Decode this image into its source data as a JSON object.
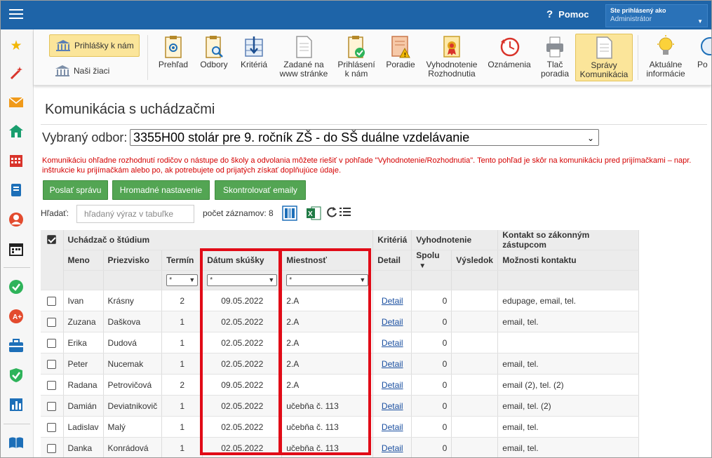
{
  "header": {
    "help_label": "Pomoc",
    "user_title": "Ste prihlásený ako",
    "user_name": "Administrátor"
  },
  "ribbon": {
    "left_buttons": [
      {
        "label": "Prihlášky k nám"
      },
      {
        "label": "Naši žiaci"
      }
    ],
    "items": [
      {
        "l1": "Prehľad",
        "l2": ""
      },
      {
        "l1": "Odbory",
        "l2": ""
      },
      {
        "l1": "Kritériá",
        "l2": ""
      },
      {
        "l1": "Zadané na",
        "l2": "www stránke"
      },
      {
        "l1": "Prihlásení",
        "l2": "k nám"
      },
      {
        "l1": "Poradie",
        "l2": ""
      },
      {
        "l1": "Vyhodnotenie",
        "l2": "Rozhodnutia"
      },
      {
        "l1": "Oznámenia",
        "l2": ""
      },
      {
        "l1": "Tlač",
        "l2": "poradia"
      },
      {
        "l1": "Správy",
        "l2": "Komunikácia"
      },
      {
        "l1": "Aktuálne",
        "l2": "informácie"
      },
      {
        "l1": "Po",
        "l2": ""
      }
    ]
  },
  "page": {
    "title": "Komunikácia s uchádzačmi",
    "odbor_label": "Vybraný odbor:",
    "odbor_value": "3355H00 stolár pre 9. ročník ZŠ - do SŠ duálne vzdelávanie",
    "warning": "Komunikáciu ohľadne rozhodnutí rodičov o nástupe do školy a odvolania môžete riešiť v pohľade \"Vyhodnotenie/Rozhodnutia\". Tento pohľad je skôr na komunikáciu pred prijímačkami – napr. inštrukcie ku prijímačkám alebo po, ak potrebujete od prijatých získať doplňujúce údaje.",
    "btn_send": "Poslať správu",
    "btn_bulk": "Hromadné nastavenie",
    "btn_check": "Skontrolovať emaily",
    "search_label": "Hľadať:",
    "search_placeholder": "hľadaný výraz v tabuľke",
    "count_label": "počet záznamov: 8"
  },
  "table": {
    "group_headers": {
      "student": "Uchádzač o štúdium",
      "criteria": "Kritériá",
      "evaluation": "Vyhodnotenie",
      "contact": "Kontakt so zákonným zástupcom"
    },
    "col_headers": {
      "meno": "Meno",
      "priezvisko": "Priezvisko",
      "termin": "Termín",
      "datum": "Dátum skúšky",
      "miestnost": "Miestnosť",
      "detail": "Detail",
      "spolu": "Spolu",
      "vysledok": "Výsledok",
      "kontakt": "Možnosti kontaktu"
    },
    "filter_value": "*",
    "sort_indicator": "▼",
    "rows": [
      {
        "meno": "Ivan",
        "priezvisko": "Krásny",
        "termin": "2",
        "datum": "09.05.2022",
        "miestnost": "2.A",
        "detail": "Detail",
        "spolu": "0",
        "vysledok": "",
        "kontakt": "edupage, email, tel."
      },
      {
        "meno": "Zuzana",
        "priezvisko": "Daškova",
        "termin": "1",
        "datum": "02.05.2022",
        "miestnost": "2.A",
        "detail": "Detail",
        "spolu": "0",
        "vysledok": "",
        "kontakt": "email, tel."
      },
      {
        "meno": "Erika",
        "priezvisko": "Dudová",
        "termin": "1",
        "datum": "02.05.2022",
        "miestnost": "2.A",
        "detail": "Detail",
        "spolu": "0",
        "vysledok": "",
        "kontakt": ""
      },
      {
        "meno": "Peter",
        "priezvisko": "Nucemak",
        "termin": "1",
        "datum": "02.05.2022",
        "miestnost": "2.A",
        "detail": "Detail",
        "spolu": "0",
        "vysledok": "",
        "kontakt": "email, tel."
      },
      {
        "meno": "Radana",
        "priezvisko": "Petrovičová",
        "termin": "2",
        "datum": "09.05.2022",
        "miestnost": "2.A",
        "detail": "Detail",
        "spolu": "0",
        "vysledok": "",
        "kontakt": "email (2), tel. (2)"
      },
      {
        "meno": "Damián",
        "priezvisko": "Deviatnikovič",
        "termin": "1",
        "datum": "02.05.2022",
        "miestnost": "učebňa č. 113",
        "detail": "Detail",
        "spolu": "0",
        "vysledok": "",
        "kontakt": "email, tel. (2)"
      },
      {
        "meno": "Ladislav",
        "priezvisko": "Malý",
        "termin": "1",
        "datum": "02.05.2022",
        "miestnost": "učebňa č. 113",
        "detail": "Detail",
        "spolu": "0",
        "vysledok": "",
        "kontakt": "email, tel."
      },
      {
        "meno": "Danka",
        "priezvisko": "Konrádová",
        "termin": "1",
        "datum": "02.05.2022",
        "miestnost": "učebňa č. 113",
        "detail": "Detail",
        "spolu": "0",
        "vysledok": "",
        "kontakt": "email, tel."
      }
    ]
  }
}
